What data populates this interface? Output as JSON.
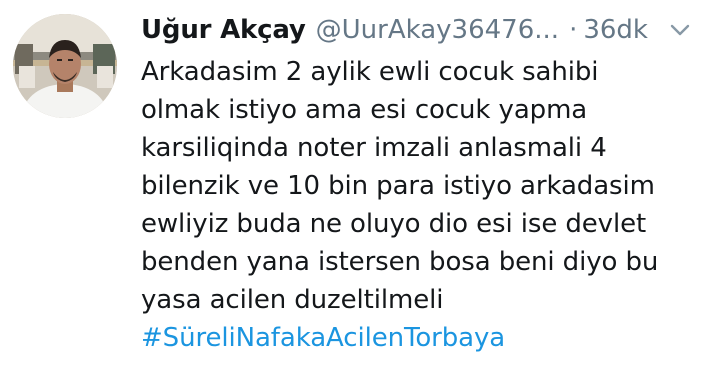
{
  "tweet": {
    "display_name": "Uğur Akçay",
    "handle": "@UurAkay36476...",
    "separator": "·",
    "time": "36dk",
    "lines": [
      "Arkadasim 2 aylik ewli cocuk sahibi",
      "olmak istiyo ama esi cocuk yapma",
      "karsiliqinda noter imzali anlasmali 4",
      "bilenzik ve 10 bin para istiyo arkadasim",
      "ewliyiz buda ne oluyo dio esi ise devlet",
      "benden yana istersen bosa beni diyo bu",
      "yasa acilen duzeltilmeli"
    ],
    "hashtag": "#SüreliNafakaAcilenTorbaya"
  },
  "icons": {
    "avatar": "profile-photo",
    "menu": "chevron-down-icon"
  },
  "colors": {
    "text": "#14171a",
    "secondary": "#657786",
    "link": "#1b95e0"
  }
}
